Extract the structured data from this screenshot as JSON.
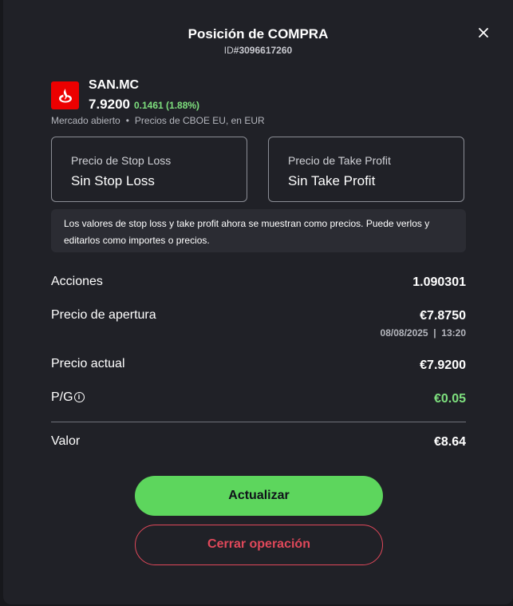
{
  "header": {
    "title": "Posición de COMPRA",
    "id_prefix": "ID",
    "id_value": "#3096617260"
  },
  "instrument": {
    "logo_icon": "santander-flame-icon",
    "brand_color": "#ec0000",
    "symbol": "SAN.MC",
    "price": "7.9200",
    "change": "0.1461 (1.88%)",
    "market_status": "Mercado abierto",
    "price_source": "Precios de CBOE EU, en EUR"
  },
  "stop_loss": {
    "label": "Precio de Stop Loss",
    "value": "Sin Stop Loss"
  },
  "take_profit": {
    "label": "Precio de Take Profit",
    "value": "Sin Take Profit"
  },
  "notice": "Los valores de stop loss y take profit ahora se muestran como precios. Puede verlos y editarlos como importes o precios.",
  "details": {
    "shares_label": "Acciones",
    "shares_value": "1.090301",
    "open_price_label": "Precio de apertura",
    "open_price_value": "€7.8750",
    "open_date": "08/08/2025  |  13:20",
    "current_price_label": "Precio actual",
    "current_price_value": "€7.9200",
    "pl_label": "P/G",
    "pl_info_icon": "info-icon",
    "pl_value": "€0.05",
    "value_label": "Valor",
    "value_value": "€8.64"
  },
  "buttons": {
    "update": "Actualizar",
    "close_position": "Cerrar operación"
  },
  "colors": {
    "accent_green": "#5dd65d",
    "positive": "#7ee07e",
    "danger": "#e0485a",
    "background": "#202127"
  }
}
